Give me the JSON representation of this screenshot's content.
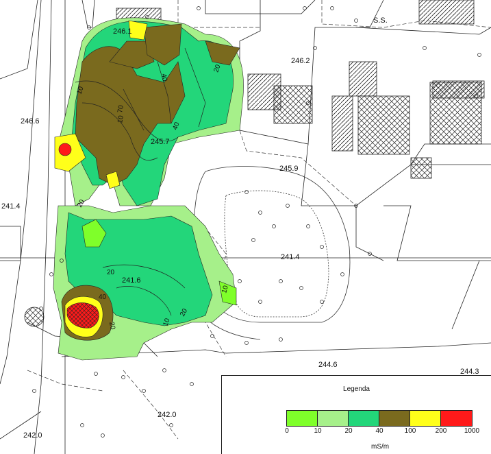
{
  "map": {
    "spot_heights": [
      "246.2",
      "246.6",
      "245.7",
      "245.9",
      "241.4",
      "241.4",
      "241.6",
      "244.6",
      "244.3",
      "242.0",
      "242.0",
      "246.1"
    ],
    "place_label": "S.S.",
    "contour_labels": [
      "10",
      "20",
      "40",
      "10",
      "70",
      "40",
      "20",
      "10",
      "20",
      "10",
      "20",
      "40",
      "20"
    ]
  },
  "legend": {
    "title": "Legenda",
    "classes": [
      {
        "from": 0,
        "to": 10,
        "color": "#7fff2a"
      },
      {
        "from": 10,
        "to": 20,
        "color": "#a6f08a"
      },
      {
        "from": 20,
        "to": 40,
        "color": "#23d67a"
      },
      {
        "from": 40,
        "to": 100,
        "color": "#7a6a1e"
      },
      {
        "from": 100,
        "to": 200,
        "color": "#ffff1a"
      },
      {
        "from": 200,
        "to": 1000,
        "color": "#ff1a1a"
      }
    ],
    "ticks": [
      "0",
      "10",
      "20",
      "40",
      "100",
      "200",
      "1000"
    ],
    "unit": "mS/m"
  }
}
